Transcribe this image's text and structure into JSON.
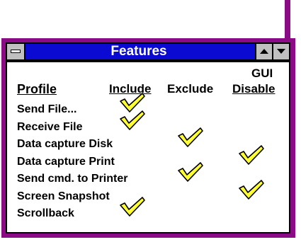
{
  "window": {
    "title": "Features"
  },
  "headers": {
    "profile": "Profile",
    "include": "Include",
    "exclude": "Exclude",
    "gui_line1": "GUI",
    "gui_line2": "Disable"
  },
  "rows": [
    {
      "label": "Send File...",
      "include": true,
      "exclude": false,
      "gui_disable": false
    },
    {
      "label": "Receive File",
      "include": true,
      "exclude": false,
      "gui_disable": false
    },
    {
      "label": "Data capture Disk",
      "include": false,
      "exclude": true,
      "gui_disable": false
    },
    {
      "label": "Data capture Print",
      "include": false,
      "exclude": false,
      "gui_disable": true
    },
    {
      "label": "Send cmd. to Printer",
      "include": false,
      "exclude": true,
      "gui_disable": false
    },
    {
      "label": "Screen Snapshot",
      "include": false,
      "exclude": false,
      "gui_disable": true
    },
    {
      "label": "Scrollback",
      "include": true,
      "exclude": false,
      "gui_disable": false
    }
  ],
  "colors": {
    "frame": "#8b0a85",
    "titlebar": "#0a0ad2",
    "check": "#ffff33"
  },
  "icons": {
    "system_menu": "system-menu-icon",
    "minimize": "up-arrow-icon",
    "maximize": "down-arrow-icon",
    "check": "checkmark-icon"
  }
}
